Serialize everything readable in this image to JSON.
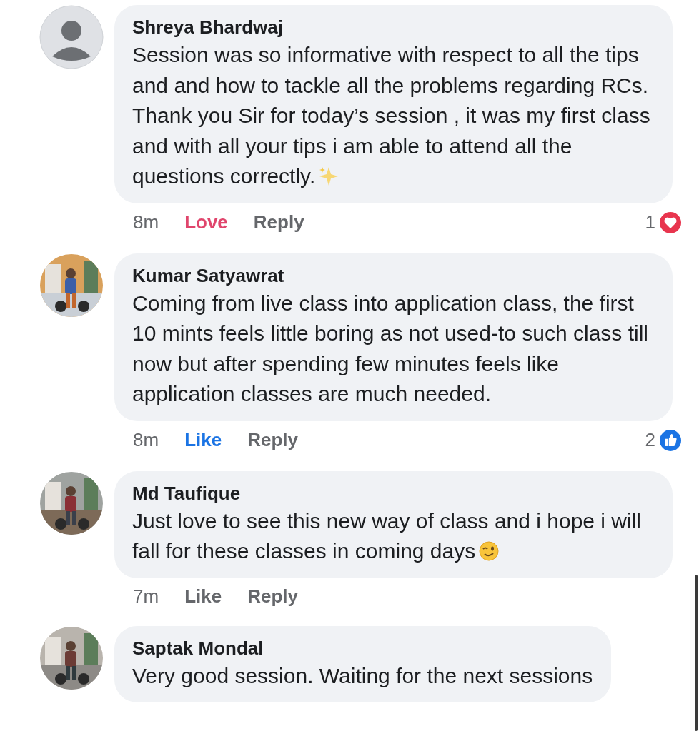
{
  "comments": [
    {
      "avatar": {
        "kind": "silhouette"
      },
      "name": "Shreya Bhardwaj",
      "text": "Session was so informative with respect to all the tips and and how to tackle all the problems regarding RCs. Thank you Sir for today’s session , it was my first class and with all your tips i am able to attend all the questions correctly.",
      "trailing_icon": {
        "kind": "sparkles"
      },
      "time": "8m",
      "action": {
        "label": "Love",
        "kind": "love"
      },
      "reply": "Reply",
      "reaction": {
        "count": "1",
        "kind": "love"
      }
    },
    {
      "name": "Kumar Satyawrat",
      "text": "Coming from live class into application class, the first 10 mints feels little boring as not used-to such class till now but after spending few minutes feels like application classes are much needed.",
      "time": "8m",
      "action": {
        "label": "Like",
        "kind": "like"
      },
      "reply": "Reply",
      "reaction": {
        "count": "2",
        "kind": "like"
      }
    },
    {
      "name": "Md Taufique",
      "text": "Just love to see this new way of class and i hope i will fall for these classes in coming days",
      "trailing_icon": {
        "kind": "wink"
      },
      "time": "7m",
      "action": {
        "label": "Like",
        "kind": "plain"
      },
      "reply": "Reply"
    },
    {
      "name": "Saptak Mondal",
      "text": "Very good session. Waiting for the next sessions"
    }
  ]
}
